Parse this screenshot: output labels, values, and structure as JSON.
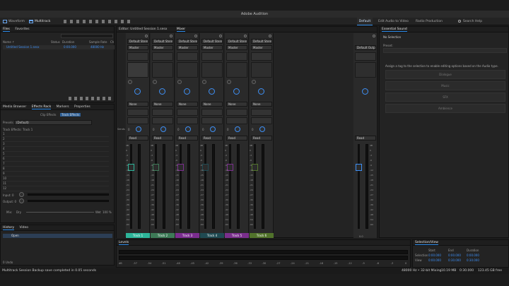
{
  "app": {
    "title": "Adobe Audition"
  },
  "toolbar": {
    "waveform": "Waveform",
    "multitrack": "Multitrack",
    "workspace_default": "Default",
    "workspace_edit_video": "Edit Audio to Video",
    "workspace_radio": "Radio Production",
    "search_placeholder": "Search Help"
  },
  "files_panel": {
    "tabs": [
      "Files",
      "Favorites"
    ],
    "columns": [
      "Name ↑",
      "Status",
      "Duration",
      "Sample Rate",
      "Ch"
    ],
    "rows": [
      {
        "name": "Untitled Session 1.sesx",
        "duration": "0:00.000",
        "rate": "48000 Hz"
      }
    ]
  },
  "effects_panel": {
    "tabs": [
      "Media Browser",
      "Effects Rack",
      "Markers",
      "Properties"
    ],
    "subtabs": [
      "Clip Effects",
      "Track Effects"
    ],
    "presets_label": "Presets:",
    "presets_value": "(Default)",
    "track_label": "Track Effects: Track 1",
    "slots": [
      "1",
      "2",
      "3",
      "4",
      "5",
      "6",
      "7",
      "8",
      "9",
      "10",
      "11",
      "12"
    ],
    "input_label": "Input: 0",
    "output_label": "Output: 0",
    "mix_label": "Mix:",
    "dry_label": "Dry",
    "wet_label": "Wet",
    "pct": "100 %"
  },
  "history_panel": {
    "tabs": [
      "History",
      "Video"
    ],
    "items": [
      "Open"
    ],
    "undo_count": "0 Undo"
  },
  "editor": {
    "tabs": [
      "Editor: Untitled Session 1.sesx",
      "Mixer"
    ]
  },
  "mixer": {
    "channels": [
      {
        "name": "Track 1",
        "color": "#2db59a",
        "fader": "0"
      },
      {
        "name": "Track 2",
        "color": "#3d7a57",
        "fader": "0"
      },
      {
        "name": "Track 3",
        "color": "#7b2d8f",
        "fader": "0"
      },
      {
        "name": "Track 4",
        "color": "#1f4a52",
        "fader": "0"
      },
      {
        "name": "Track 5",
        "color": "#7a2f8c",
        "fader": "0"
      },
      {
        "name": "Track 6",
        "color": "#51732b",
        "fader": "0"
      }
    ],
    "master": {
      "name": "Mix",
      "fader": "0.0"
    },
    "input_default": "Default Stere",
    "output_default": "Master",
    "master_output": "Default Outp",
    "mode_read": "Read",
    "none_label": "None",
    "pan_value": "0",
    "ms": "M S",
    "sends_label": "Sends",
    "meter_vals": [
      "dB",
      "0",
      "-3",
      "-6",
      "-9",
      "-12",
      "-15",
      "-18",
      "-21",
      "-24",
      "-27",
      "-30",
      "-36",
      "-42",
      "-48",
      "-54",
      "-60"
    ],
    "scale_vals": [
      "+6",
      "0",
      "-6",
      "-12",
      "-18",
      "-24",
      "-30"
    ]
  },
  "essential_sound": {
    "title": "Essential Sound",
    "no_selection": "No Selection",
    "preset_label": "Preset:",
    "hint": "Assign a tag to the selection to enable editing options based on the Audio type.",
    "types": [
      "Dialogue",
      "Music",
      "SFX",
      "Ambience"
    ]
  },
  "levels": {
    "title": "Levels",
    "scale": [
      "dB",
      "-57",
      "-54",
      "-51",
      "-48",
      "-45",
      "-42",
      "-39",
      "-36",
      "-33",
      "-30",
      "-27",
      "-24",
      "-21",
      "-18",
      "-15",
      "-12",
      "-9",
      "-6",
      "-3",
      "0"
    ]
  },
  "selection_view": {
    "title": "Selection/View",
    "headers": [
      "Start",
      "End",
      "Duration"
    ],
    "rows": [
      {
        "label": "Selection",
        "start": "0:00.000",
        "end": "0:00.000",
        "dur": "0:00.000"
      },
      {
        "label": "View",
        "start": "0:00.000",
        "end": "0:30.000",
        "dur": "0:30.000"
      }
    ]
  },
  "status": {
    "message": "Multitrack Session Backup save completed in 0.05 seconds",
    "format": "48000 Hz • 32-bit Mixing",
    "size": "10.19 MB",
    "duration": "0:30.000",
    "free": "123.45 GB free"
  },
  "colors": {
    "accent": "#2d8ceb",
    "bg": "#232323"
  }
}
